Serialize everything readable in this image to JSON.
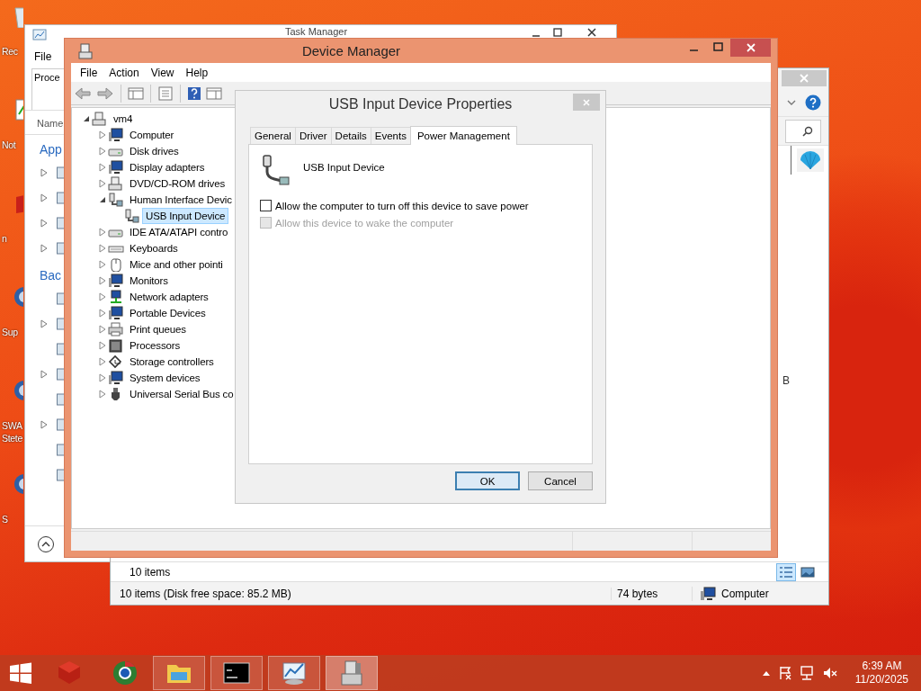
{
  "desktop_icons": [
    {
      "label": "Rec",
      "kind": "bin"
    },
    {
      "label": "Not",
      "kind": "doc"
    },
    {
      "label": "n",
      "kind": "red"
    },
    {
      "label": "Sup",
      "kind": "globe"
    },
    {
      "label": "SWA Stete",
      "kind": "globe"
    },
    {
      "label": "S",
      "kind": "globe"
    }
  ],
  "task_manager": {
    "title": "Task Manager",
    "menu": [
      "File"
    ],
    "tab": "Proce",
    "column": "Name",
    "groups": [
      {
        "label": "App",
        "rows": [
          {
            "expandable": true
          },
          {
            "expandable": true
          },
          {
            "expandable": true
          },
          {
            "expandable": true
          }
        ]
      },
      {
        "label": "Bac",
        "rows": [
          {
            "expandable": false
          },
          {
            "expandable": true
          },
          {
            "expandable": false
          },
          {
            "expandable": true
          },
          {
            "expandable": false
          },
          {
            "expandable": true
          },
          {
            "expandable": false
          },
          {
            "expandable": false
          }
        ]
      }
    ]
  },
  "explorer": {
    "side_text": "B",
    "items_count": "10 items",
    "views": [
      {
        "kind": "details",
        "selected": true
      },
      {
        "kind": "tiles",
        "selected": false
      }
    ],
    "status_bar": [
      "10 items (Disk free space: 85.2 MB)",
      "74 bytes",
      "Computer"
    ]
  },
  "device_manager": {
    "title": "Device Manager",
    "menu": [
      "File",
      "Action",
      "View",
      "Help"
    ],
    "tree": {
      "label": "vm4",
      "kind": "host",
      "expanded": true,
      "children": [
        {
          "label": "Computer",
          "kind": "monitor",
          "expanded": false
        },
        {
          "label": "Disk drives",
          "kind": "drive",
          "expanded": false
        },
        {
          "label": "Display adapters",
          "kind": "monitor",
          "expanded": false
        },
        {
          "label": "DVD/CD-ROM drives",
          "kind": "host",
          "expanded": false
        },
        {
          "label": "Human Interface Devic",
          "kind": "plug",
          "expanded": true,
          "children": [
            {
              "label": "USB Input Device",
              "kind": "plug",
              "selected": true
            }
          ]
        },
        {
          "label": "IDE ATA/ATAPI contro",
          "kind": "drive",
          "expanded": false
        },
        {
          "label": "Keyboards",
          "kind": "keyboard",
          "expanded": false
        },
        {
          "label": "Mice and other pointi",
          "kind": "mouse",
          "expanded": false
        },
        {
          "label": "Monitors",
          "kind": "monitor",
          "expanded": false
        },
        {
          "label": "Network adapters",
          "kind": "network",
          "expanded": false
        },
        {
          "label": "Portable Devices",
          "kind": "monitor",
          "expanded": false
        },
        {
          "label": "Print queues",
          "kind": "printer",
          "expanded": false
        },
        {
          "label": "Processors",
          "kind": "chip",
          "expanded": false
        },
        {
          "label": "Storage controllers",
          "kind": "storage",
          "expanded": false
        },
        {
          "label": "System devices",
          "kind": "monitor",
          "expanded": false
        },
        {
          "label": "Universal Serial Bus co",
          "kind": "usb",
          "expanded": false
        }
      ]
    }
  },
  "dialog": {
    "title": "USB Input Device Properties",
    "tabs": [
      {
        "label": "General",
        "selected": false
      },
      {
        "label": "Driver",
        "selected": false
      },
      {
        "label": "Details",
        "selected": false
      },
      {
        "label": "Events",
        "selected": false
      },
      {
        "label": "Power Management",
        "selected": true
      }
    ],
    "device_name": "USB Input Device",
    "options": [
      {
        "label": "Allow the computer to turn off this device to save power",
        "checked": false,
        "disabled": false
      },
      {
        "label": "Allow this device to wake the computer",
        "checked": false,
        "disabled": true
      }
    ],
    "buttons": [
      {
        "label": "OK",
        "default": true
      },
      {
        "label": "Cancel",
        "default": false
      }
    ]
  },
  "taskbar": {
    "apps": [
      {
        "kind": "box",
        "active": false
      },
      {
        "kind": "globe",
        "active": false
      },
      {
        "kind": "folder",
        "active": true
      },
      {
        "kind": "console",
        "active": true
      },
      {
        "kind": "chart",
        "active": true
      },
      {
        "kind": "device",
        "active": true,
        "selected": true
      }
    ],
    "time": "6:39 AM",
    "date": "11/20/2025"
  }
}
